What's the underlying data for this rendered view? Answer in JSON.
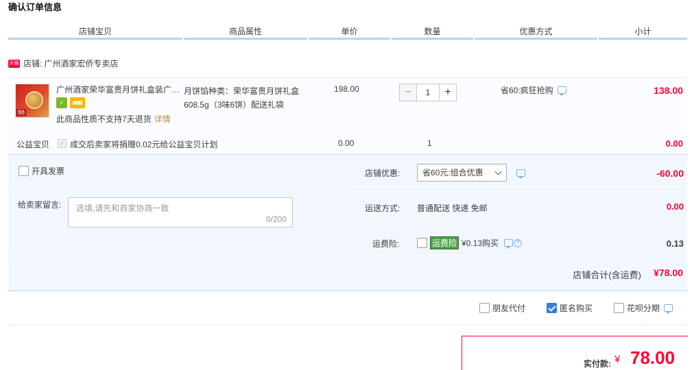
{
  "title": "确认订单信息",
  "columns": [
    "店铺宝贝",
    "商品属性",
    "单价",
    "数量",
    "优惠方式",
    "小计"
  ],
  "shop": {
    "badge": "天猫",
    "label": "店铺:",
    "name": "广州酒家宏侨专卖店"
  },
  "item": {
    "title": "广州酒家荣华富贵月饼礼盒装广州特产",
    "thumb_tag": "88",
    "return_note": "此商品性质不支持7天退货",
    "detail_link": "详情",
    "attribute": "月饼馅种类：荣华富贵月饼礼盒608.5g（3味6饼）配送礼袋",
    "price": "198.00",
    "quantity": "1",
    "qty_minus": "−",
    "qty_plus": "+",
    "discount": "省60:疯狂抢购",
    "subtotal": "138.00"
  },
  "charity": {
    "label": "公益宝贝",
    "text": "成交后卖家将捐赠0.02元给公益宝贝计划",
    "price": "0.00",
    "quantity": "1",
    "subtotal": "0.00"
  },
  "invoice": {
    "label": "开具发票"
  },
  "message": {
    "label": "给卖家留言:",
    "placeholder": "选填,请先和商家协商一致",
    "counter": "0/200"
  },
  "shop_discount": {
    "label": "店铺优惠:",
    "selected": "省60元:组合优惠",
    "amount": "-60.00"
  },
  "shipping": {
    "label": "运送方式:",
    "value": "普通配送 快递 免邮",
    "amount": "0.00"
  },
  "insurance": {
    "label": "运费险:",
    "badge": "运费险",
    "price_text": "¥0.13购买",
    "amount": "0.13"
  },
  "shop_total": {
    "label": "店铺合计(含运费)",
    "value": "¥78.00"
  },
  "options": [
    {
      "label": "朋友代付",
      "checked": false
    },
    {
      "label": "匿名购买",
      "checked": true
    },
    {
      "label": "花呗分期",
      "checked": false
    }
  ],
  "payment": {
    "label": "实付款:",
    "currency": "¥",
    "value": "78.00"
  },
  "colors": {
    "accent_red": "#ff0036",
    "header_underline": "#b2d1ff",
    "panel_bg": "#f2f7ff",
    "checkbox_blue": "#3b7cdb"
  }
}
